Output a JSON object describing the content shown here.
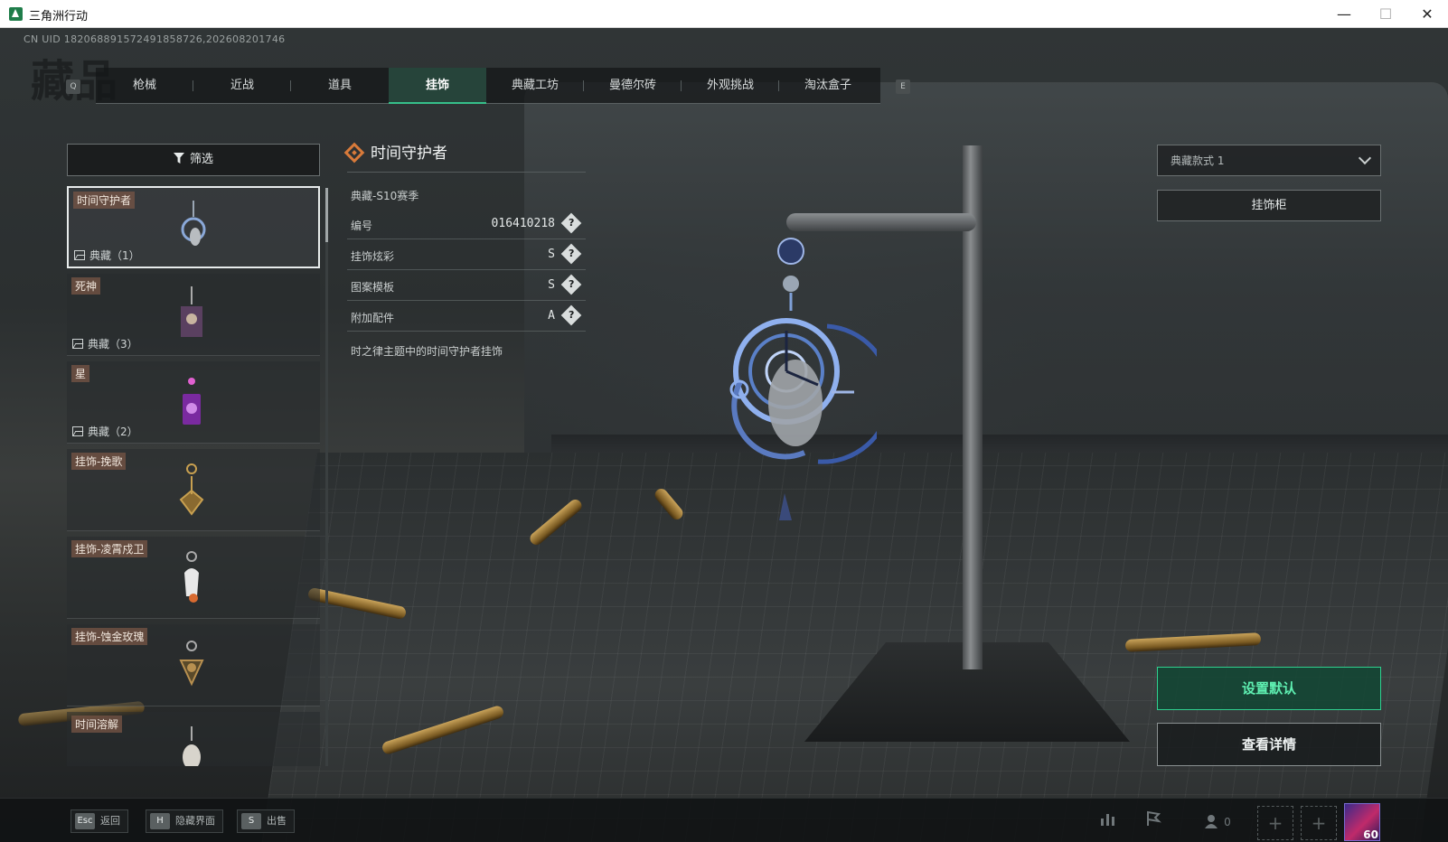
{
  "window": {
    "title": "三角洲行动",
    "minimize": "—",
    "maximize": "☐",
    "close": "✕"
  },
  "uid": "CN UID 18206889157249185872​6,202608201746",
  "page_watermark": "藏品",
  "tabs": {
    "left_key": "Q",
    "right_key": "E",
    "items": [
      {
        "label": "枪械"
      },
      {
        "label": "近战"
      },
      {
        "label": "道具"
      },
      {
        "label": "挂饰"
      },
      {
        "label": "典藏工坊"
      },
      {
        "label": "曼德尔砖"
      },
      {
        "label": "外观挑战"
      },
      {
        "label": "淘汰盒子"
      }
    ],
    "active": "挂饰"
  },
  "filter": {
    "label": "筛选"
  },
  "list": {
    "items": [
      {
        "name": "时间守护者",
        "badge": "典藏（1）",
        "selected": true,
        "color": "#8aa8d8"
      },
      {
        "name": "死神",
        "badge": "典藏（3）",
        "color": "#7a5a8a"
      },
      {
        "name": "星",
        "badge": "典藏（2）",
        "color": "#b04ac8"
      },
      {
        "name": "挂饰-挽歌",
        "badge": "",
        "color": "#c8a050"
      },
      {
        "name": "挂饰-凌霄戍卫",
        "badge": "",
        "color": "#d86a30"
      },
      {
        "name": "挂饰-蚀金玫瑰",
        "badge": "",
        "color": "#b89050"
      },
      {
        "name": "时间溶解",
        "badge": "",
        "color": "#d8d4cc"
      }
    ]
  },
  "detail": {
    "title": "时间守护者",
    "season": "典藏-S10赛季",
    "rows": [
      {
        "key": "编号",
        "value": "016410218",
        "help": "?"
      },
      {
        "key": "挂饰炫彩",
        "value": "S",
        "help": "?"
      },
      {
        "key": "图案模板",
        "value": "S",
        "help": "?"
      },
      {
        "key": "附加配件",
        "value": "A",
        "help": "?"
      }
    ],
    "description": "时之律主题中的时间守护者挂饰"
  },
  "right_panel": {
    "style_select": "典藏款式 1",
    "cabinet_button": "挂饰柜",
    "set_default_button": "设置默认",
    "view_detail_button": "查看详情"
  },
  "bottom": {
    "hints": [
      {
        "key": "Esc",
        "label": "返回"
      },
      {
        "key": "H",
        "label": "隐藏界面"
      },
      {
        "key": "S",
        "label": "出售"
      }
    ],
    "friends_count": "0",
    "level": "60"
  },
  "colors": {
    "accent": "#2fd08f",
    "tag_bg": "#78564a"
  }
}
